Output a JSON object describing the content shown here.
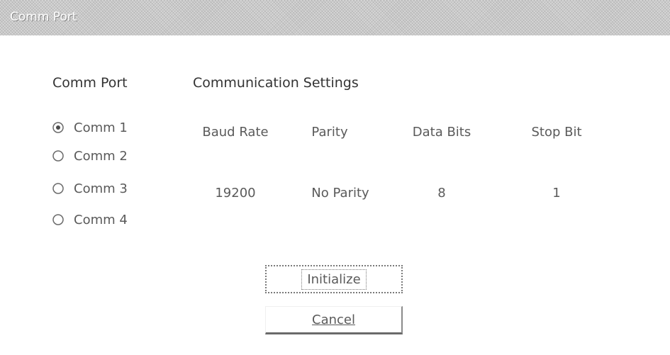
{
  "window": {
    "title": "Comm Port"
  },
  "headers": {
    "comm_port": "Comm Port",
    "settings": "Communication Settings"
  },
  "ports": [
    {
      "label": "Comm 1",
      "selected": true
    },
    {
      "label": "Comm 2",
      "selected": false
    },
    {
      "label": "Comm 3",
      "selected": false
    },
    {
      "label": "Comm 4",
      "selected": false
    }
  ],
  "settings": {
    "baud_rate": {
      "label": "Baud Rate",
      "value": "19200"
    },
    "parity": {
      "label": "Parity",
      "value": "No Parity"
    },
    "data_bits": {
      "label": "Data Bits",
      "value": "8"
    },
    "stop_bit": {
      "label": "Stop Bit",
      "value": "1"
    }
  },
  "buttons": {
    "initialize": "Initialize",
    "cancel": "Cancel"
  }
}
